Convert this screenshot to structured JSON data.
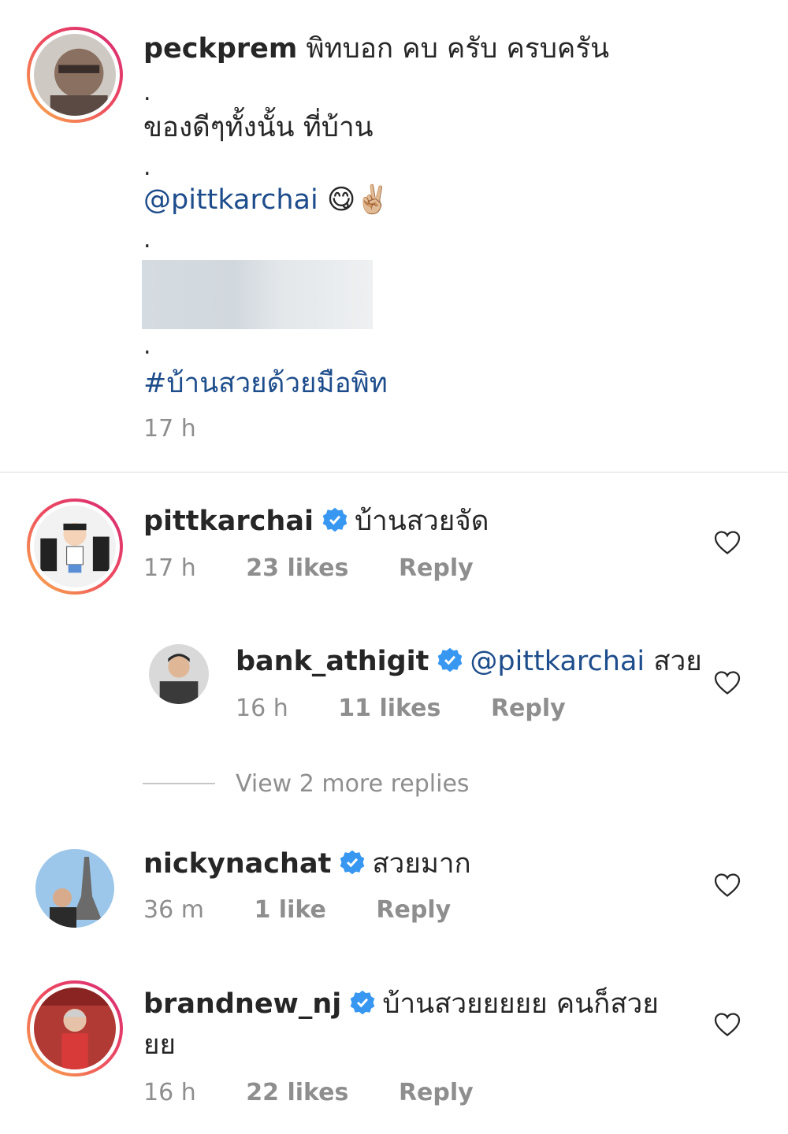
{
  "post": {
    "username": "peckprem",
    "line1": "พิทบอก คบ ครับ ครบครัน",
    "dot": ".",
    "line2": "ของดีๆทั้งนั้น ที่บ้าน",
    "mention": "@pittkarchai",
    "emojis": "😋✌🏼",
    "hashtag": "#บ้านสวยด้วยมือพิท",
    "time": "17 h"
  },
  "comments": [
    {
      "username": "pittkarchai",
      "text": "บ้านสวยจัด",
      "time": "17 h",
      "likes": "23 likes",
      "reply": "Reply"
    },
    {
      "username": "bank_athigit",
      "mention": "@pittkarchai",
      "text": "สวย",
      "time": "16 h",
      "likes": "11 likes",
      "reply": "Reply"
    },
    {
      "username": "nickynachat",
      "text": "สวยมาก",
      "time": "36 m",
      "likes": "1 like",
      "reply": "Reply"
    },
    {
      "username": "brandnew_nj",
      "text": "บ้านสวยยยยย คนก็สวย",
      "text2": "ยย",
      "time": "16 h",
      "likes": "22 likes",
      "reply": "Reply"
    }
  ],
  "view_more": "View 2 more replies",
  "icons": {
    "verified": "verified-badge-icon",
    "heart": "heart-outline-icon"
  },
  "colors": {
    "verified": "#3897f0",
    "mention": "#1e4d8c",
    "meta": "#8e8e8e"
  }
}
